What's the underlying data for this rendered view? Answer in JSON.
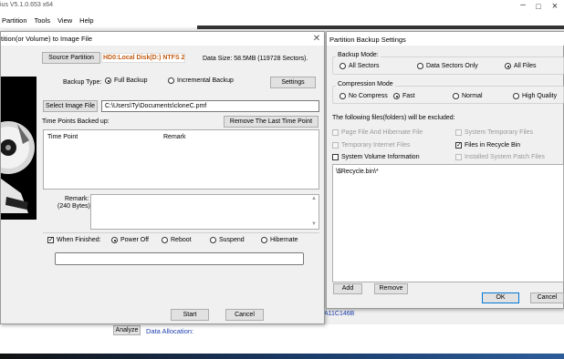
{
  "app": {
    "title": "ius V5.1.0.653 x64",
    "menu": [
      "Partition",
      "Tools",
      "View",
      "Help"
    ],
    "bottom": {
      "analyze_label": "Analyze",
      "data_allocation_label": "Data Allocation:",
      "hex_text": "A11C146B"
    }
  },
  "image_dialog": {
    "title": "tition(or Volume) to Image File",
    "source_partition_label": "Source Partition",
    "source_partition_value": "HD0:Local Disk(D:) NTFS 20.3",
    "data_size": "Data Size: 58.5MB (119728 Sectors).",
    "backup_type_label": "Backup Type:",
    "backup_type_options": [
      "Full Backup",
      "Incremental Backup"
    ],
    "backup_type_selected": "Full Backup",
    "settings_label": "Settings",
    "select_image_label": "Select Image File",
    "image_path": "C:\\Users\\Ty\\Documents\\cloneC.pmf",
    "time_points_label": "Time Points Backed up:",
    "remove_last_label": "Remove The Last Time Point",
    "columns": [
      "Time Point",
      "Remark"
    ],
    "remark_label": "Remark:",
    "remark_bytes": "(240 Bytes)",
    "when_finished_label": "When Finished:",
    "when_finished_checked": true,
    "finish_options": [
      "Power Off",
      "Reboot",
      "Suspend",
      "Hibernate"
    ],
    "finish_selected": "Power Off",
    "start_label": "Start",
    "cancel_label": "Cancel"
  },
  "settings_dialog": {
    "title": "Partition Backup Settings",
    "backup_mode_label": "Backup Mode:",
    "backup_modes": [
      "All Sectors",
      "Data Sectors Only",
      "All Files"
    ],
    "backup_mode_selected": "All Files",
    "compression_label": "Compression Mode",
    "compression_modes": [
      "No Compress",
      "Fast",
      "Normal",
      "High Quality"
    ],
    "compression_selected": "Fast",
    "excluded_label": "The following files(folders) will be excluded:",
    "exclusions": {
      "page_file": {
        "label": "Page File And Hibernate File",
        "checked": false,
        "enabled": false
      },
      "system_temp": {
        "label": "System Temporary Files",
        "checked": false,
        "enabled": false
      },
      "temp_internet": {
        "label": "Temporary Internet Files",
        "checked": false,
        "enabled": false
      },
      "recycle_bin": {
        "label": "Files in Recycle Bin",
        "checked": true,
        "enabled": true
      },
      "svi": {
        "label": "System Volume Information",
        "checked": false,
        "enabled": true
      },
      "patch": {
        "label": "Installed System Patch Files",
        "checked": false,
        "enabled": false
      }
    },
    "excluded_items": [
      "\\$Recycle.bin\\*"
    ],
    "add_label": "Add",
    "remove_label": "Remove",
    "ok_label": "OK",
    "cancel_label": "Cancel"
  },
  "colors": {
    "partition_label": "#c05a10",
    "link_blue": "#1e40af",
    "default_button_border": "#0078d7"
  }
}
